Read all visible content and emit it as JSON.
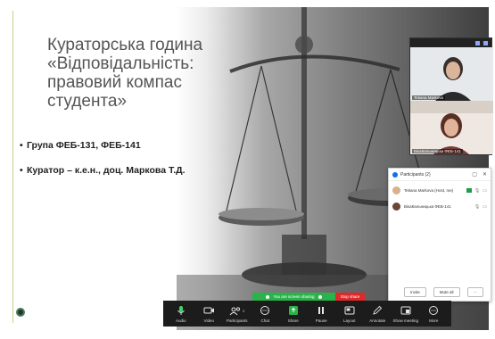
{
  "slide": {
    "title_lines": [
      "Кураторська година",
      "«Відповідальність:",
      "правовий компас",
      "студента»"
    ],
    "bullets": [
      "Група ФЕБ-131, ФЕБ-141",
      "Куратор – к.е.н., доц. Маркова Т.Д."
    ]
  },
  "gallery": {
    "tiles": [
      {
        "name": "Tetiana Markova"
      },
      {
        "name": "ВікаКальницька ФЕБ-141"
      }
    ]
  },
  "participants": {
    "title": "Participants (2)",
    "rows": [
      {
        "name": "Tetiana Markova (Host, me)"
      },
      {
        "name": "ВікаКальницька ФЕБ-141"
      }
    ],
    "invite_label": "Invite",
    "mute_all_label": "Mute all",
    "more_label": "···"
  },
  "share_banner": {
    "text": "You are screen sharing",
    "stop_label": "Stop share"
  },
  "toolbar": {
    "audio": "Audio",
    "video": "Video",
    "participants": "Participants",
    "participants_count": "2",
    "chat": "Chat",
    "share": "Share",
    "pause": "Pause",
    "layout": "Layout",
    "annotate": "Annotate",
    "show_meeting": "Show meeting",
    "more": "More"
  },
  "colors": {
    "share_green": "#2ab34a",
    "stop_red": "#e02828",
    "toolbar_bg": "#1c1c1c",
    "zoom_blue": "#0e71eb"
  }
}
